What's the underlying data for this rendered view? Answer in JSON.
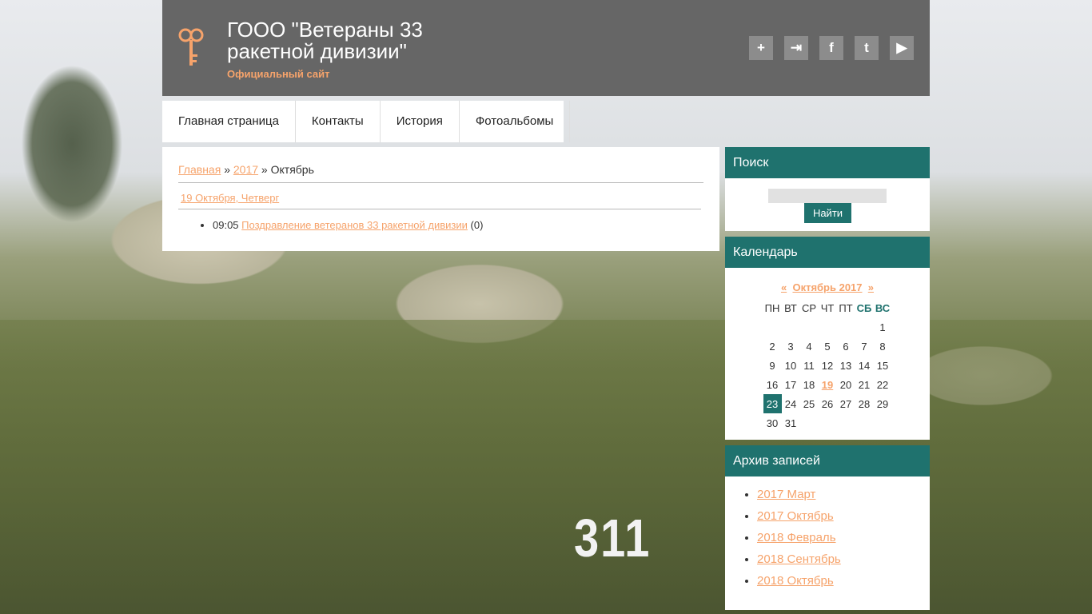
{
  "header": {
    "title": "ГООО \"Ветераны 33 ракетной дивизии\"",
    "subtitle": "Официальный сайт",
    "icons": [
      "add-user-icon",
      "login-icon",
      "facebook-icon",
      "twitter-icon",
      "youtube-icon"
    ],
    "icon_glyphs": [
      "+",
      "⇥",
      "f",
      "t",
      "▶"
    ]
  },
  "nav": {
    "items": [
      "Главная страница",
      "Контакты",
      "История",
      "Фотоальбомы"
    ]
  },
  "content": {
    "breadcrumb": {
      "home": "Главная",
      "sep1": "»",
      "year": "2017",
      "sep2": "»",
      "current": "Октябрь"
    },
    "date_heading": "19 Октября, Четверг",
    "entries": [
      {
        "time": "09:05",
        "title": "Поздравление ветеранов 33 ракетной дивизии",
        "comments": "(0)"
      }
    ]
  },
  "sidebar": {
    "search": {
      "title": "Поиск",
      "placeholder": "",
      "button_label": "Найти"
    },
    "calendar": {
      "title": "Календарь",
      "prev": "«",
      "month_label": "Октябрь 2017",
      "next": "»",
      "weekdays": [
        "ПН",
        "ВТ",
        "СР",
        "ЧТ",
        "ПТ",
        "СБ",
        "ВС"
      ],
      "weeks": [
        [
          "",
          "",
          "",
          "",
          "",
          "",
          "1"
        ],
        [
          "2",
          "3",
          "4",
          "5",
          "6",
          "7",
          "8"
        ],
        [
          "9",
          "10",
          "11",
          "12",
          "13",
          "14",
          "15"
        ],
        [
          "16",
          "17",
          "18",
          "19",
          "20",
          "21",
          "22"
        ],
        [
          "23",
          "24",
          "25",
          "26",
          "27",
          "28",
          "29"
        ],
        [
          "30",
          "31",
          "",
          "",
          "",
          "",
          ""
        ]
      ],
      "linked_day": "19",
      "today": "23"
    },
    "archive": {
      "title": "Архив записей",
      "items": [
        "2017 Март",
        "2017 Октябрь",
        "2018 Февраль",
        "2018 Сентябрь",
        "2018 Октябрь"
      ]
    }
  },
  "background": {
    "vehicle_number": "311"
  },
  "colors": {
    "header_bg": "#666666",
    "accent": "#f6a36b",
    "teal": "#1f726e"
  }
}
